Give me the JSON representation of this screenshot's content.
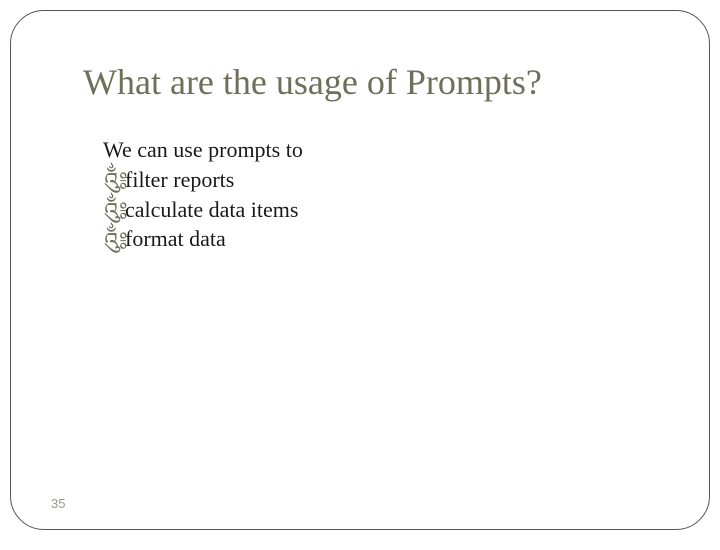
{
  "slide": {
    "title": "What are the usage of Prompts?",
    "intro": "We can use prompts to",
    "bullets": [
      "filter reports",
      "calculate data items",
      "format data"
    ],
    "bullet_glyph": "༃",
    "page_number": "35"
  }
}
